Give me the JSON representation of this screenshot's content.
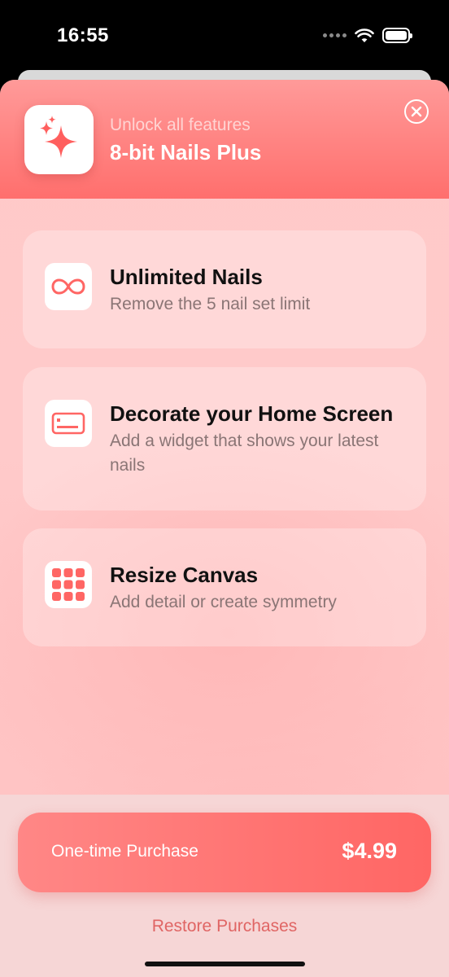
{
  "status_bar": {
    "time": "16:55"
  },
  "header": {
    "subtitle": "Unlock all features",
    "title": "8-bit Nails Plus"
  },
  "features": [
    {
      "icon": "infinity-icon",
      "title": "Unlimited Nails",
      "description": "Remove the 5 nail set limit"
    },
    {
      "icon": "widget-icon",
      "title": "Decorate your Home Screen",
      "description": "Add a widget that shows your latest nails"
    },
    {
      "icon": "grid-icon",
      "title": "Resize Canvas",
      "description": "Add detail or create symmetry"
    }
  ],
  "purchase": {
    "label": "One-time Purchase",
    "price": "$4.99"
  },
  "restore": {
    "label": "Restore Purchases"
  },
  "colors": {
    "accent": "#ff6f6d",
    "header_subtitle": "#ffd4d3",
    "link": "#e06564"
  }
}
